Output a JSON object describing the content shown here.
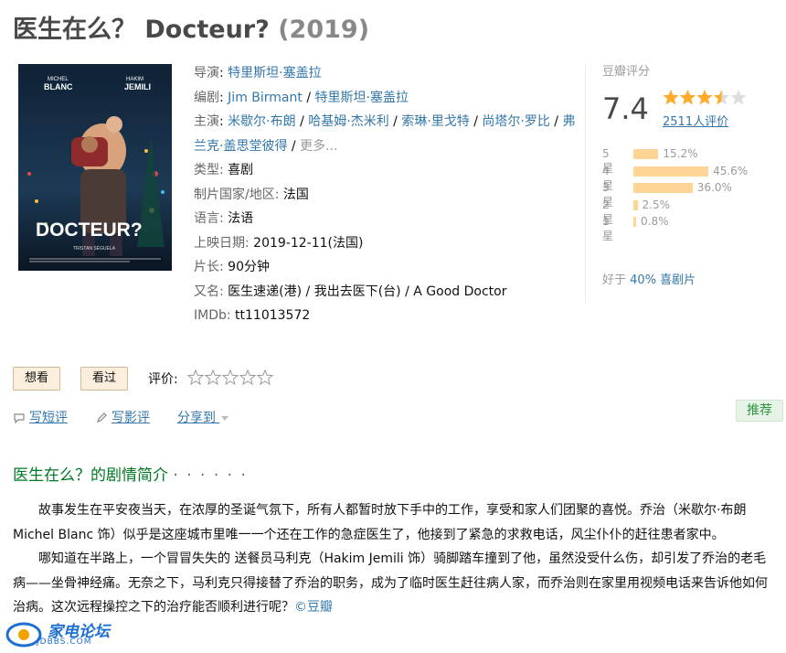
{
  "header": {
    "title": "医生在么？ Docteur?",
    "year": "(2019)"
  },
  "poster": {
    "actor_left_first": "MICHEL",
    "actor_left_last": "BLANC",
    "actor_right_first": "HAKIM",
    "actor_right_last": "JEMILI",
    "logo": "DOCTEUR?",
    "credit": "TRISTAN SÉGUELA"
  },
  "info": {
    "director_label": "导演",
    "director": "特里斯坦·塞盖拉",
    "writer_label": "编剧",
    "writer_1": "Jim Birmant",
    "writer_2": "特里斯坦·塞盖拉",
    "cast_label": "主演",
    "cast": [
      "米歇尔·布朗",
      "哈基姆·杰米利",
      "索琳·里戈特",
      "尚塔尔·罗比",
      "弗兰克·盖思堂彼得"
    ],
    "more": "更多...",
    "genre_label": "类型:",
    "genre": "喜剧",
    "country_label": "制片国家/地区:",
    "country": "法国",
    "language_label": "语言:",
    "language": "法语",
    "release_label": "上映日期:",
    "release": "2019-12-11(法国)",
    "runtime_label": "片长:",
    "runtime": "90分钟",
    "aka_label": "又名:",
    "aka": "医生速递(港) / 我出去医下(台) / A Good Doctor",
    "imdb_label": "IMDb:",
    "imdb": "tt11013572"
  },
  "rating": {
    "label": "豆瓣评分",
    "score": "7.4",
    "stars_value": 3.5,
    "votes": "2511人评价",
    "distribution": [
      {
        "label": "5星",
        "percent": 15.2,
        "text": "15.2%"
      },
      {
        "label": "4星",
        "percent": 45.6,
        "text": "45.6%"
      },
      {
        "label": "3星",
        "percent": 36.0,
        "text": "36.0%"
      },
      {
        "label": "2星",
        "percent": 2.5,
        "text": "2.5%"
      },
      {
        "label": "1星",
        "percent": 0.8,
        "text": "0.8%"
      }
    ],
    "better_prefix": "好于",
    "better_link": "40% 喜剧片"
  },
  "actions": {
    "want": "想看",
    "watched": "看过",
    "rate_label": "评价:",
    "short_review": "写短评",
    "long_review": "写影评",
    "share": "分享到",
    "recommend": "推荐"
  },
  "colors": {
    "link": "#3377aa",
    "green": "#007722",
    "star": "#ffac2d",
    "bar": "#ffd596"
  },
  "summary": {
    "title": "医生在么？的剧情简介",
    "dots": "· · · · · ·",
    "para1": "故事发生在平安夜当天，在浓厚的圣诞气氛下，所有人都暂时放下手中的工作，享受和家人们团聚的喜悦。乔治（米歇尔·布朗 Michel Blanc 饰）似乎是这座城市里唯一一个还在工作的急症医生了，他接到了紧急的求救电话，风尘仆仆的赶往患者家中。",
    "para2": "哪知道在半路上，一个冒冒失失的 送餐员马利克（Hakim Jemili 饰）骑脚踏车撞到了他，虽然没受什么伤，却引发了乔治的老毛病——坐骨神经痛。无奈之下，马利克只得接替了乔治的职务，成为了临时医生赶往病人家，而乔治则在家里用视频电话来告诉他如何治病。这次远程操控之下的治疗能否顺利进行呢？",
    "source": "©豆瓣"
  },
  "watermark": {
    "text": "家电论坛",
    "sub": "JDBBS.COM"
  }
}
